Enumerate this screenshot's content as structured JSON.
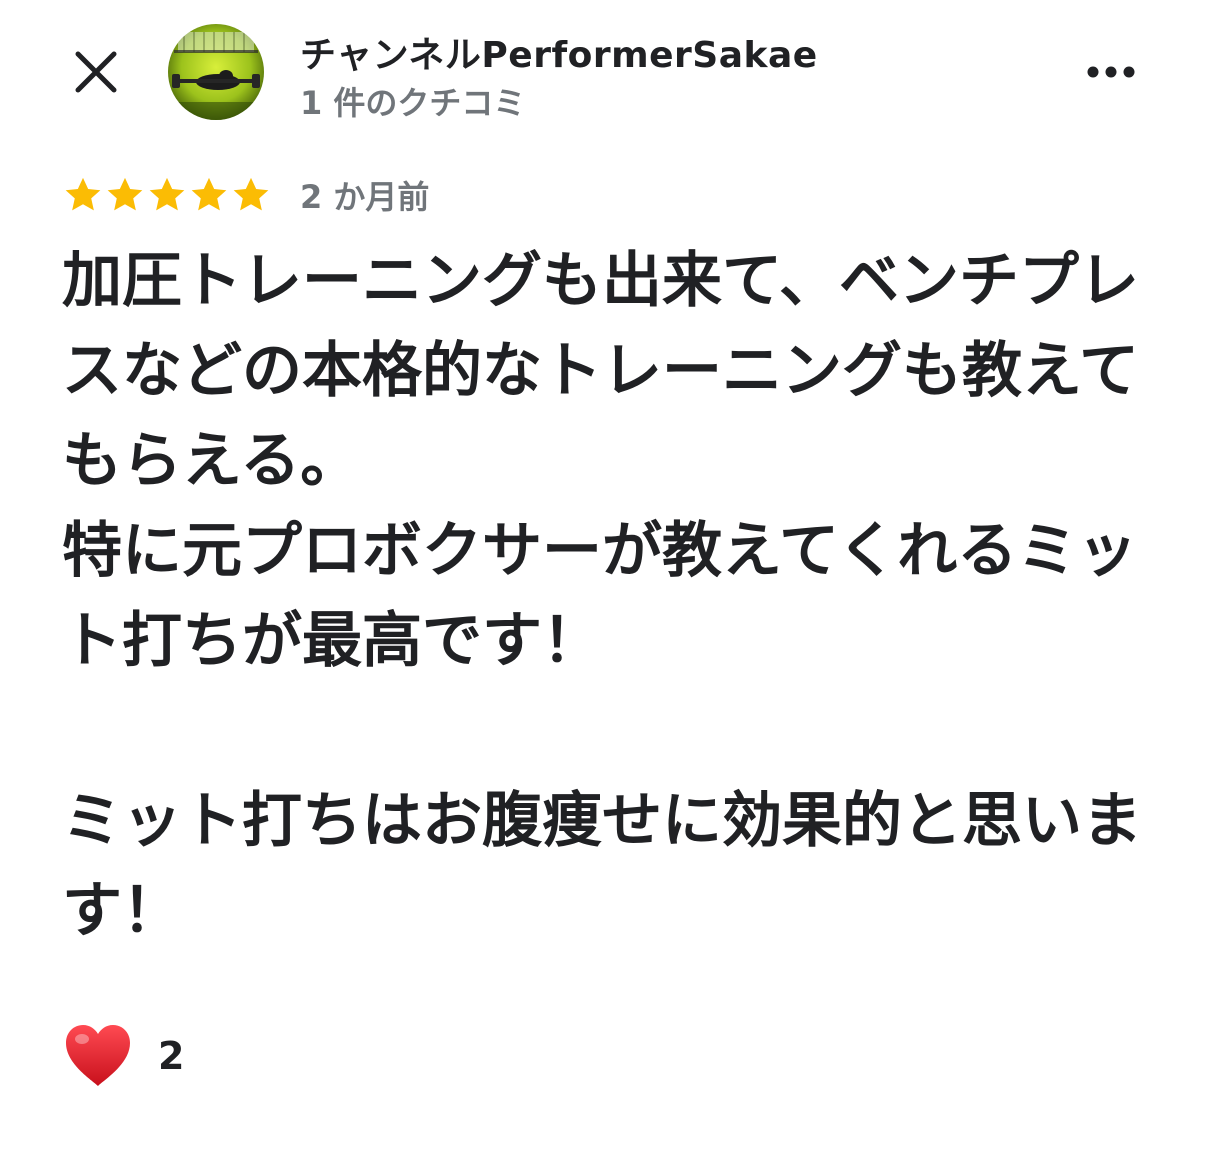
{
  "header": {
    "close_icon": "close-icon",
    "author_name": "チャンネルPerformerSakae",
    "review_count": "1 件のクチコミ",
    "more_icon": "more-horizontal-icon"
  },
  "review": {
    "rating": 5,
    "rating_max": 5,
    "star_color": "#fbbc04",
    "date": "2 か月前",
    "text": "加圧トレーニングも出来て、ベンチプレスなどの本格的なトレーニングも教えてもらえる。\n特に元プロボクサーが教えてくれるミット打ちが最高です！\n\nミット打ちはお腹痩せに効果的と思います！"
  },
  "reactions": {
    "heart_icon": "heart-icon",
    "heart_color": "#e0202c",
    "like_count": "2"
  }
}
